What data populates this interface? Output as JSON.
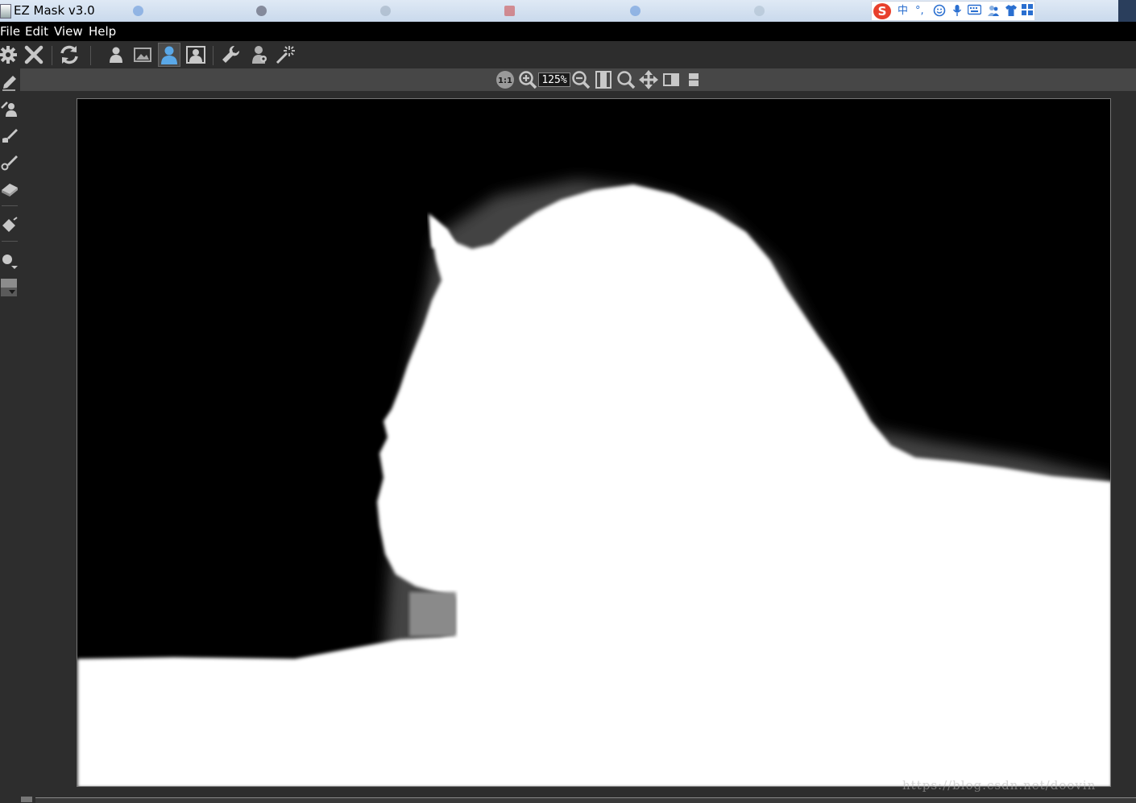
{
  "window": {
    "title": "EZ Mask v3.0"
  },
  "menu": {
    "items": [
      {
        "id": "file",
        "label": "File"
      },
      {
        "id": "edit",
        "label": "Edit"
      },
      {
        "id": "view",
        "label": "View"
      },
      {
        "id": "help",
        "label": "Help"
      }
    ]
  },
  "ime_toolbar": {
    "logo": "S",
    "mode_label": "中",
    "punct_label": "°,",
    "icons": [
      "emoji-icon",
      "microphone-icon",
      "keyboard-icon",
      "people-icon",
      "shirt-icon",
      "grid-icon"
    ]
  },
  "toolbar": {
    "tools": [
      {
        "name": "settings-icon",
        "active": false
      },
      {
        "name": "close-icon",
        "active": false
      },
      {
        "name": "refresh-icon",
        "active": false
      },
      {
        "name": "foreground-person-icon",
        "active": false
      },
      {
        "name": "background-image-icon",
        "active": false
      },
      {
        "name": "mask-view-icon",
        "active": true
      },
      {
        "name": "composite-view-icon",
        "active": false
      },
      {
        "name": "wrench-icon",
        "active": false
      },
      {
        "name": "person-settings-icon",
        "active": false
      },
      {
        "name": "magic-wand-icon",
        "active": false
      }
    ]
  },
  "view_toolbar": {
    "actual_size_label": "1:1",
    "zoom_value": "125%"
  },
  "left_tools": [
    "pencil-icon",
    "keep-brush-icon",
    "drop-brush-icon",
    "hair-brush-icon",
    "eraser-icon",
    "fill-icon",
    "brush-size-icon",
    "color-swatch-icon"
  ],
  "watermark": {
    "text": "https://blog.csdn.net/doovin"
  },
  "colors": {
    "app_bg": "#2d2d2d",
    "menu_bg": "#000000",
    "mask_foreground": "#ffffff",
    "mask_background": "#000000",
    "active_accent": "#5aa8e8"
  }
}
